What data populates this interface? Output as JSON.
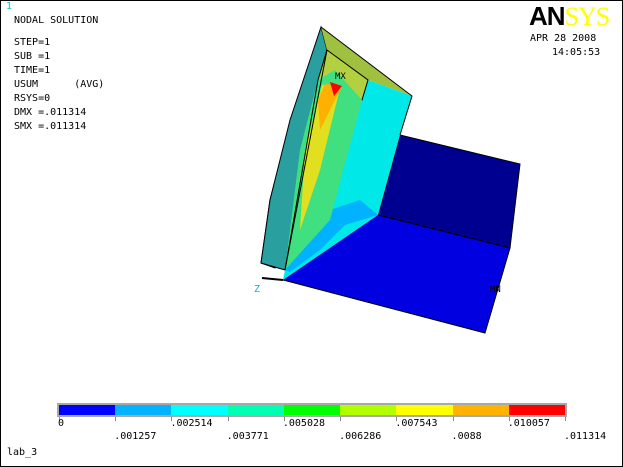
{
  "window_number": "1",
  "title": "NODAL SOLUTION",
  "info": [
    "STEP=1",
    "SUB =1",
    "TIME=1",
    "USUM      (AVG)",
    "RSYS=0",
    "DMX =.011314",
    "SMX =.011314"
  ],
  "logo": {
    "part1": "AN",
    "part2": "SYS"
  },
  "date": "APR 28 2008",
  "time": "14:05:53",
  "plot_labels": {
    "max": "MX",
    "min": "MN",
    "axis": "Z"
  },
  "legend": {
    "colors": [
      "#0000ff",
      "#00b2ff",
      "#00ffff",
      "#00ffb2",
      "#00ff00",
      "#b2ff00",
      "#ffff00",
      "#ffb200",
      "#ff0000"
    ],
    "values": [
      "0",
      ".001257",
      ".002514",
      ".003771",
      ".005028",
      ".006286",
      ".007543",
      ".0088",
      ".010057",
      ".011314"
    ]
  },
  "footer_label": "lab_3"
}
